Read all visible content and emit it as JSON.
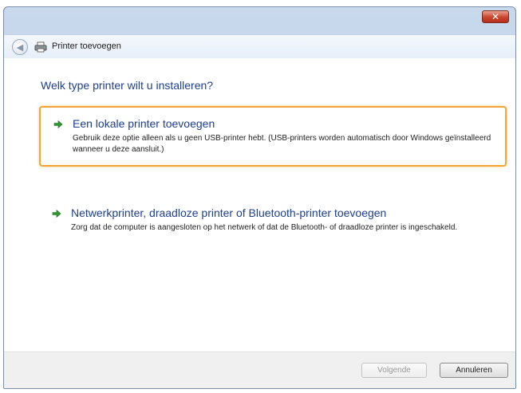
{
  "window": {
    "close_symbol": "✕"
  },
  "navbar": {
    "back_symbol": "◀",
    "title": "Printer toevoegen"
  },
  "main": {
    "question": "Welk type printer wilt u installeren?",
    "options": [
      {
        "title": "Een lokale printer toevoegen",
        "description": "Gebruik deze optie alleen als u geen USB-printer hebt. (USB-printers worden automatisch door Windows geïnstalleerd wanneer u deze aansluit.)",
        "selected": true
      },
      {
        "title": "Netwerkprinter, draadloze printer of Bluetooth-printer toevoegen",
        "description": "Zorg dat de computer is aangesloten op het netwerk of dat de Bluetooth- of draadloze printer is ingeschakeld.",
        "selected": false
      }
    ]
  },
  "footer": {
    "next_label": "Volgende",
    "next_enabled": false,
    "cancel_label": "Annuleren"
  },
  "colors": {
    "heading": "#1d3f8f",
    "selection_border": "#f2a637",
    "arrow_green": "#2e9a2e"
  },
  "icons": {
    "back": "back-arrow-icon",
    "printer": "printer-icon",
    "option_arrow": "green-arrow-icon",
    "close": "close-icon"
  }
}
